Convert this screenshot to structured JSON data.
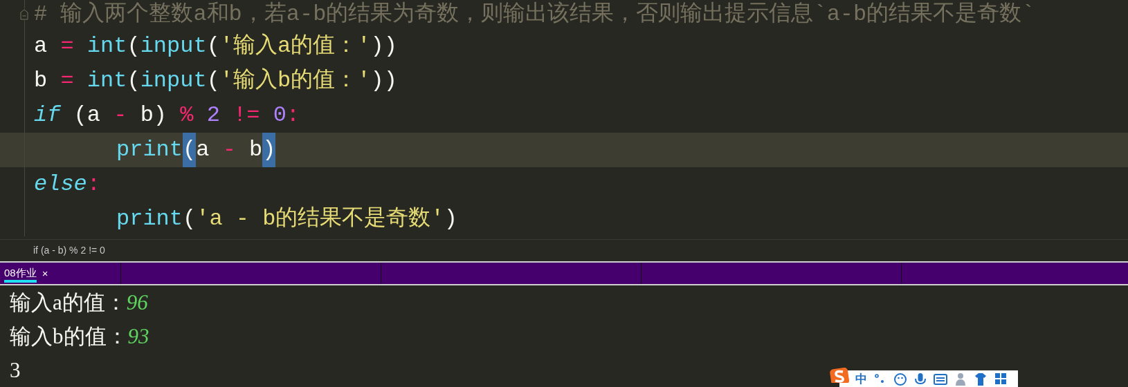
{
  "editor": {
    "lines": [
      {
        "folded": false,
        "highlighted": false,
        "indented": false,
        "tokens": [
          {
            "text": "# 输入两个整数a和b，若a-b的结果为奇数，则输出该结果，否则输出提示信息`a-b的结果不是奇数`",
            "kind": "comment"
          }
        ]
      },
      {
        "highlighted": false,
        "indented": false,
        "tokens": [
          {
            "text": "a ",
            "kind": "plain"
          },
          {
            "text": "=",
            "kind": "operator"
          },
          {
            "text": " int",
            "kind": "builtin"
          },
          {
            "text": "(",
            "kind": "plain"
          },
          {
            "text": "input",
            "kind": "builtin"
          },
          {
            "text": "(",
            "kind": "plain"
          },
          {
            "text": "'输入a的值：'",
            "kind": "string"
          },
          {
            "text": "))",
            "kind": "plain"
          }
        ]
      },
      {
        "highlighted": false,
        "indented": false,
        "tokens": [
          {
            "text": "b ",
            "kind": "plain"
          },
          {
            "text": "=",
            "kind": "operator"
          },
          {
            "text": " int",
            "kind": "builtin"
          },
          {
            "text": "(",
            "kind": "plain"
          },
          {
            "text": "input",
            "kind": "builtin"
          },
          {
            "text": "(",
            "kind": "plain"
          },
          {
            "text": "'输入b的值：'",
            "kind": "string"
          },
          {
            "text": "))",
            "kind": "plain"
          }
        ]
      },
      {
        "highlighted": false,
        "indented": false,
        "tokens": [
          {
            "text": "if",
            "kind": "keyword"
          },
          {
            "text": " (a ",
            "kind": "plain"
          },
          {
            "text": "-",
            "kind": "operator"
          },
          {
            "text": " b) ",
            "kind": "plain"
          },
          {
            "text": "%",
            "kind": "operator"
          },
          {
            "text": " 2",
            "kind": "number"
          },
          {
            "text": " !=",
            "kind": "operator"
          },
          {
            "text": " 0",
            "kind": "number"
          },
          {
            "text": ":",
            "kind": "operator"
          }
        ]
      },
      {
        "highlighted": true,
        "indented": true,
        "tokens": [
          {
            "text": "print",
            "kind": "builtin"
          },
          {
            "text": "(",
            "kind": "match"
          },
          {
            "text": "a ",
            "kind": "plain"
          },
          {
            "text": "-",
            "kind": "operator"
          },
          {
            "text": " b",
            "kind": "plain"
          },
          {
            "text": ")",
            "kind": "match"
          }
        ]
      },
      {
        "highlighted": false,
        "indented": false,
        "tokens": [
          {
            "text": "else",
            "kind": "keyword"
          },
          {
            "text": ":",
            "kind": "operator"
          }
        ]
      },
      {
        "highlighted": false,
        "indented": true,
        "tokens": [
          {
            "text": "print",
            "kind": "builtin"
          },
          {
            "text": "(",
            "kind": "plain"
          },
          {
            "text": "'a - b的结果不是奇数'",
            "kind": "string"
          },
          {
            "text": ")",
            "kind": "plain"
          }
        ]
      }
    ]
  },
  "status_text": "if (a - b) % 2 != 0",
  "panel_tabs": [
    {
      "label": "08作业",
      "selected": true,
      "close": "×"
    }
  ],
  "output": {
    "lines": [
      [
        {
          "text": "输入a的值：",
          "kind": "prompt"
        },
        {
          "text": "96",
          "kind": "input"
        }
      ],
      [
        {
          "text": "输入b的值：",
          "kind": "prompt"
        },
        {
          "text": "93",
          "kind": "input"
        }
      ],
      [
        {
          "text": "3",
          "kind": "prompt"
        }
      ]
    ]
  },
  "ime_toolbar": {
    "mode": "中"
  }
}
